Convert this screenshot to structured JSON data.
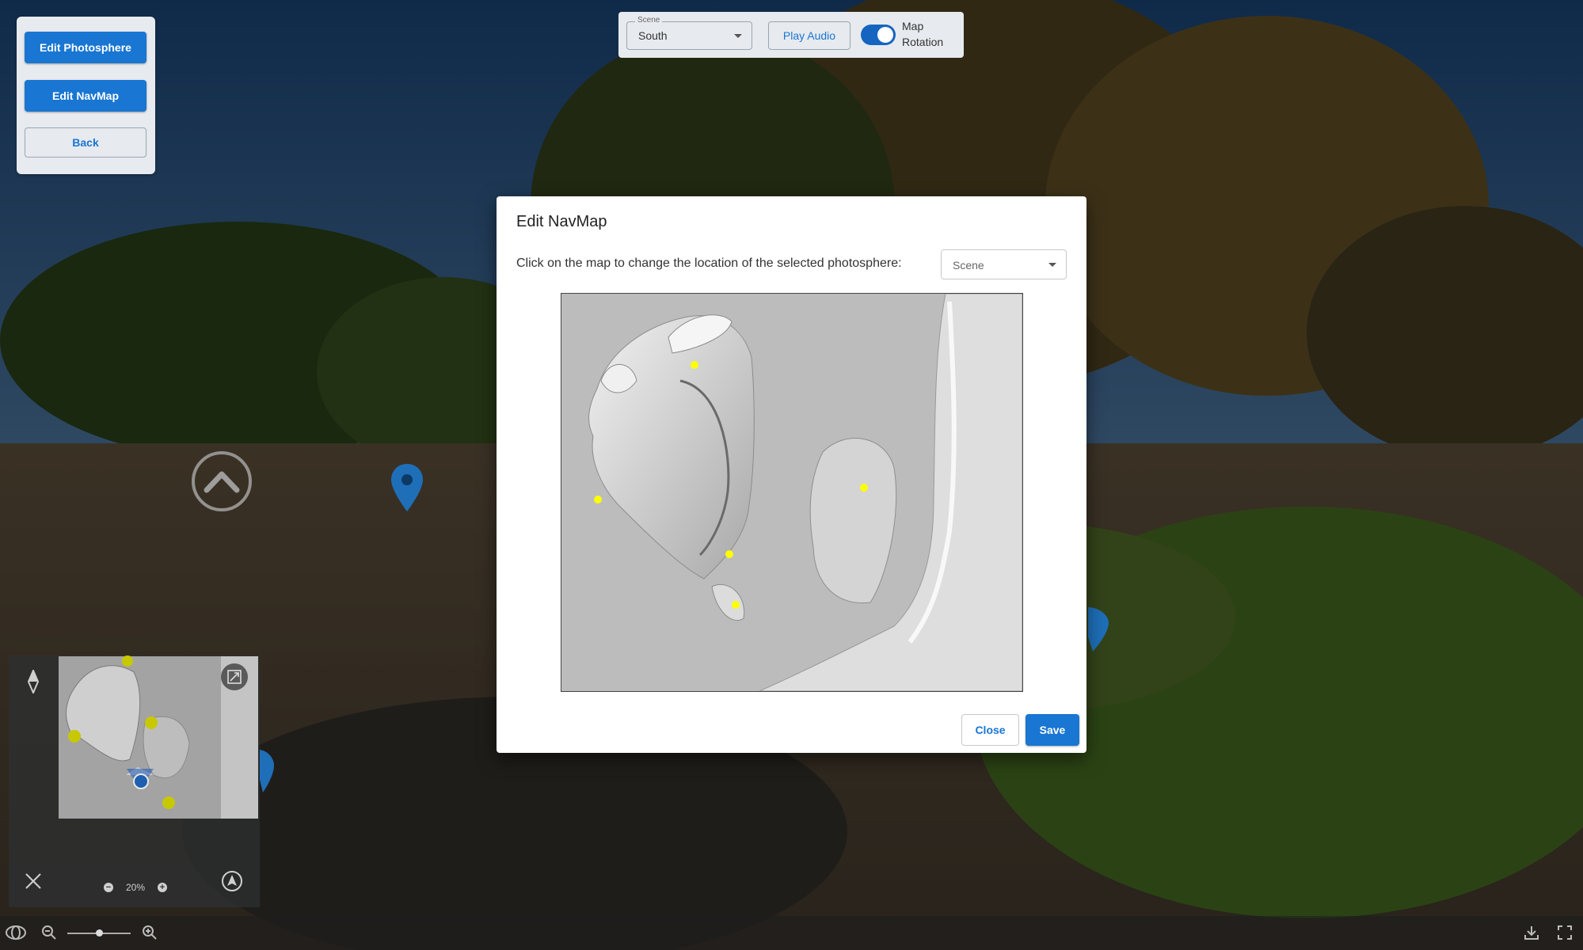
{
  "edit_panel": {
    "edit_photosphere_label": "Edit Photosphere",
    "edit_navmap_label": "Edit NavMap",
    "back_label": "Back"
  },
  "toolbar": {
    "scene_legend": "Scene",
    "scene_value": "South",
    "play_audio_label": "Play Audio",
    "map_rotation_label": "Map Rotation",
    "map_rotation_on": true
  },
  "minimap": {
    "zoom_level": "20%",
    "zoom_out_symbol": "−",
    "zoom_in_symbol": "+",
    "icons": [
      "compass-icon",
      "expand-icon",
      "close-icon",
      "recenter-icon"
    ]
  },
  "modal": {
    "title": "Edit NavMap",
    "instruction": "Click on the map to change the location of the selected photosphere:",
    "scene_select_placeholder": "Scene",
    "close_label": "Close",
    "save_label": "Save"
  },
  "colors": {
    "accent": "#1976d2",
    "hotspot": "#ffff00",
    "pin": "#1e6fb8"
  },
  "bottom_bar": {
    "icons": [
      "gyroscope-icon",
      "zoom-out-icon",
      "zoom-in-icon",
      "download-icon",
      "fullscreen-icon"
    ]
  }
}
